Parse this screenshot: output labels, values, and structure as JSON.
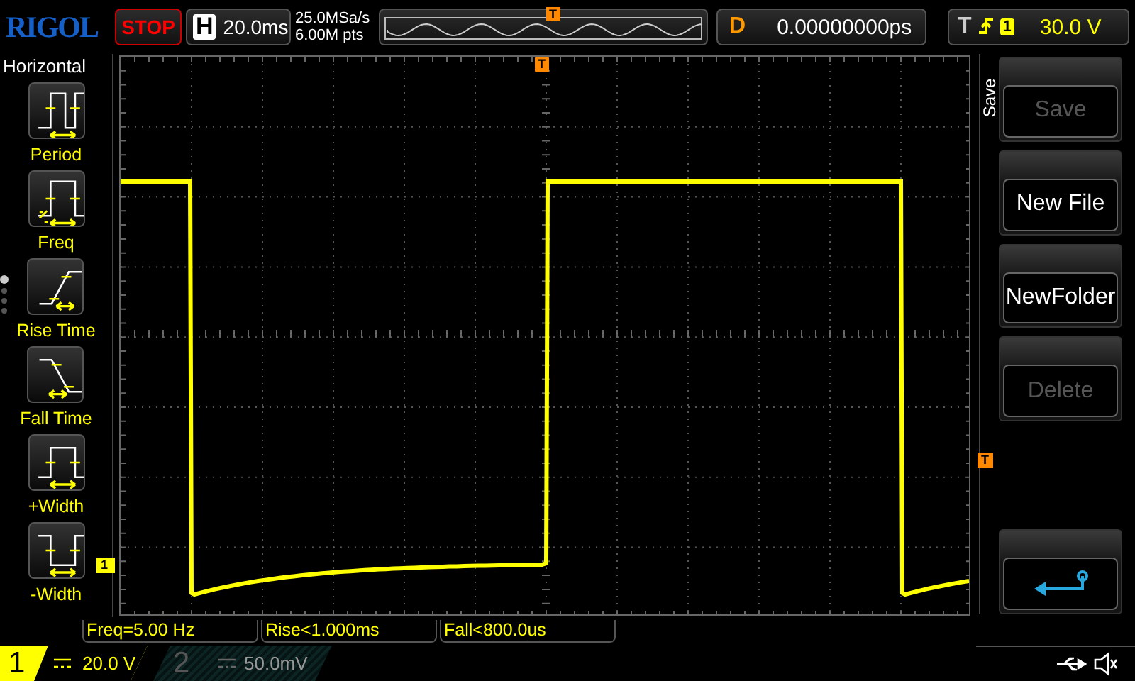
{
  "top_bar": {
    "brand": "RIGOL",
    "run_state": "STOP",
    "horizontal": {
      "label": "H",
      "timebase": "20.0ms"
    },
    "acquisition": {
      "sample_rate": "25.0MSa/s",
      "memory_depth": "6.00M pts"
    },
    "overview_marker": "T",
    "delay": {
      "label": "D",
      "value": "0.00000000ps"
    },
    "trigger": {
      "label": "T",
      "source": "1",
      "level": "30.0 V"
    }
  },
  "left_menu": {
    "title": "Horizontal",
    "items": [
      {
        "label": "Period",
        "kind": "period"
      },
      {
        "label": "Freq",
        "kind": "freq"
      },
      {
        "label": "Rise Time",
        "kind": "rise"
      },
      {
        "label": "Fall Time",
        "kind": "fall"
      },
      {
        "label": "+Width",
        "kind": "pwidth"
      },
      {
        "label": "-Width",
        "kind": "nwidth"
      }
    ],
    "pages": [
      {
        "selected": true
      },
      {
        "selected": false
      },
      {
        "selected": false
      },
      {
        "selected": false
      }
    ]
  },
  "grid": {
    "trigger_position_marker": "T",
    "trigger_level_marker": "T",
    "channel_marker": "1"
  },
  "right_menu": {
    "title": "Save",
    "buttons": [
      {
        "kind": "text",
        "label": "Save",
        "disabled": true
      },
      {
        "kind": "text",
        "label": "New File",
        "disabled": false
      },
      {
        "kind": "text",
        "label": "NewFolder",
        "disabled": false
      },
      {
        "kind": "text",
        "label": "Delete",
        "disabled": true
      },
      {
        "kind": "back",
        "disabled": false
      }
    ]
  },
  "measurements": [
    "Freq=5.00 Hz",
    "Rise<1.000ms",
    "Fall<800.0us"
  ],
  "channels": [
    {
      "number": "1",
      "scale": "20.0 V",
      "selected": true
    },
    {
      "number": "2",
      "scale": "50.0mV",
      "selected": false
    }
  ]
}
